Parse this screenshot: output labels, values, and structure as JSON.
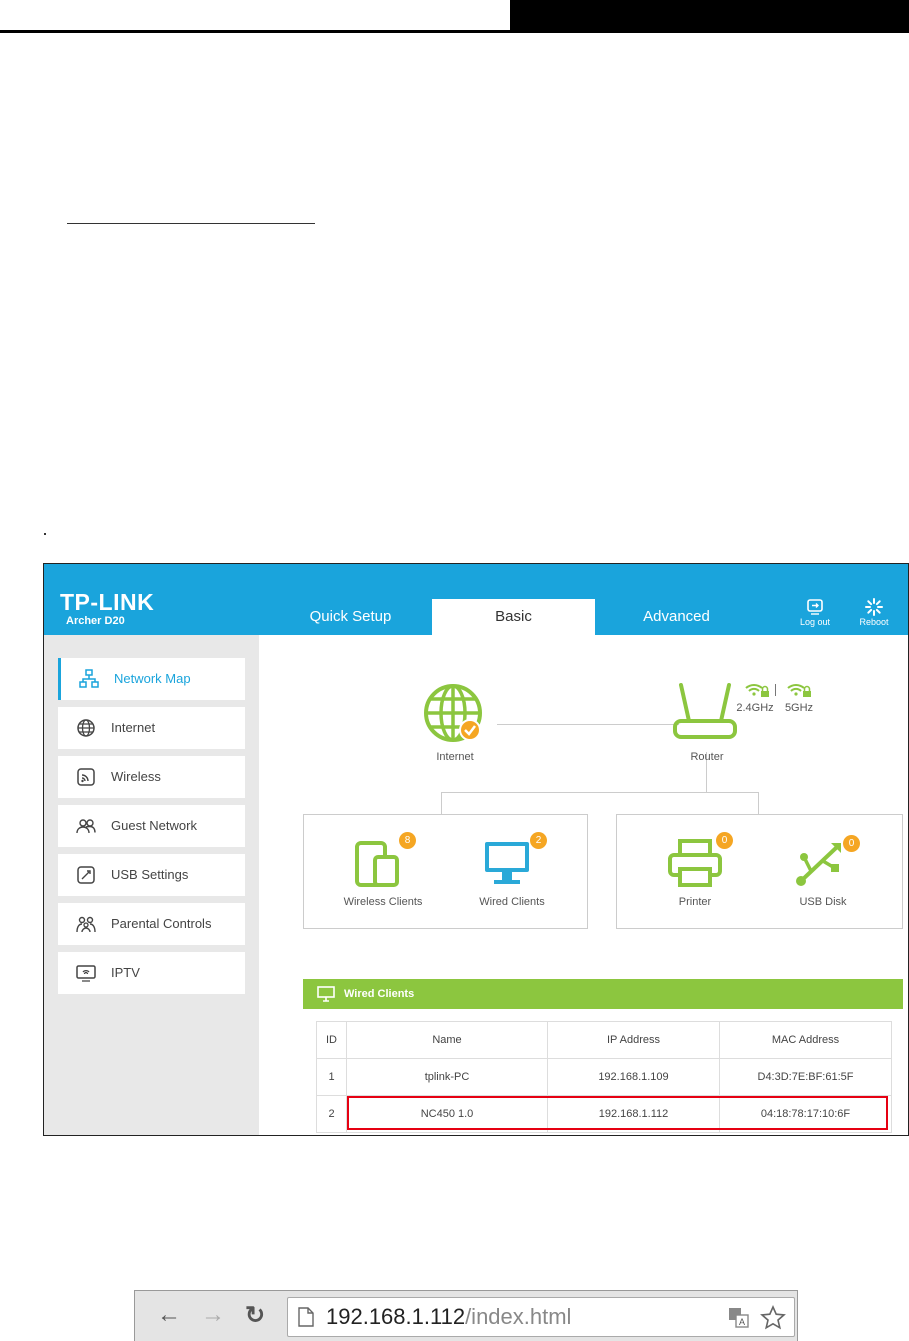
{
  "header": {
    "brand": "TP-LINK",
    "model": "Archer D20",
    "tabs": [
      "Quick Setup",
      "Basic",
      "Advanced"
    ],
    "active_tab": "Basic",
    "logout_label": "Log out",
    "reboot_label": "Reboot"
  },
  "sidebar": {
    "items": [
      {
        "label": "Network Map",
        "icon": "network-map-icon"
      },
      {
        "label": "Internet",
        "icon": "globe-icon"
      },
      {
        "label": "Wireless",
        "icon": "wireless-icon"
      },
      {
        "label": "Guest Network",
        "icon": "guest-network-icon"
      },
      {
        "label": "USB Settings",
        "icon": "usb-settings-icon"
      },
      {
        "label": "Parental Controls",
        "icon": "parental-controls-icon"
      },
      {
        "label": "IPTV",
        "icon": "iptv-icon"
      }
    ]
  },
  "map": {
    "internet_label": "Internet",
    "router_label": "Router",
    "band_24": "2.4GHz",
    "band_5": "5GHz",
    "wireless_clients": {
      "label": "Wireless Clients",
      "count": "8"
    },
    "wired_clients": {
      "label": "Wired Clients",
      "count": "2"
    },
    "printer": {
      "label": "Printer",
      "count": "0"
    },
    "usb_disk": {
      "label": "USB Disk",
      "count": "0"
    }
  },
  "wired_panel": {
    "title": "Wired Clients",
    "columns": [
      "ID",
      "Name",
      "IP Address",
      "MAC Address"
    ],
    "rows": [
      [
        "1",
        "tplink-PC",
        "192.168.1.109",
        "D4:3D:7E:BF:61:5F"
      ],
      [
        "2",
        "NC450 1.0",
        "192.168.1.112",
        "04:18:78:17:10:6F"
      ]
    ]
  },
  "browser": {
    "url_host": "192.168.1.112",
    "url_path": "/index.html"
  },
  "colors": {
    "header_blue": "#1aa4dc",
    "icon_green": "#8cc63f",
    "badge_orange": "#f5a623",
    "highlight_red": "#e60012",
    "monitor_blue": "#2aa9d8"
  }
}
